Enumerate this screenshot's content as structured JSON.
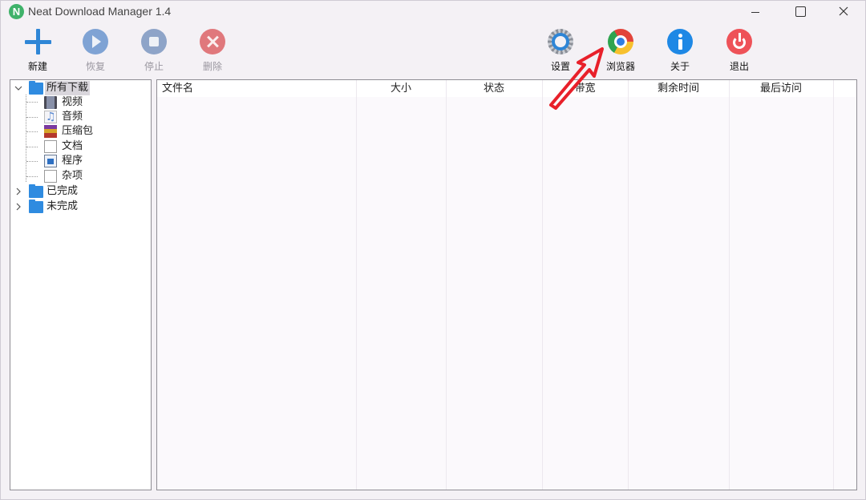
{
  "window": {
    "title": "Neat Download Manager 1.4",
    "logo_letter": "N"
  },
  "toolbar": {
    "new_label": "新建",
    "resume_label": "恢复",
    "stop_label": "停止",
    "delete_label": "删除",
    "settings_label": "设置",
    "browser_label": "浏览器",
    "about_label": "关于",
    "exit_label": "退出"
  },
  "tree": {
    "all_downloads": "所有下载",
    "video": "视频",
    "audio": "音频",
    "archive": "压缩包",
    "document": "文档",
    "program": "程序",
    "misc": "杂项",
    "completed": "已完成",
    "incomplete": "未完成"
  },
  "columns": {
    "filename": "文件名",
    "size": "大小",
    "status": "状态",
    "bandwidth": "带宽",
    "time_left": "剩余时间",
    "last_access": "最后访问"
  },
  "colors": {
    "accent": "#2f86d6",
    "annotation_arrow": "#e8202a"
  }
}
